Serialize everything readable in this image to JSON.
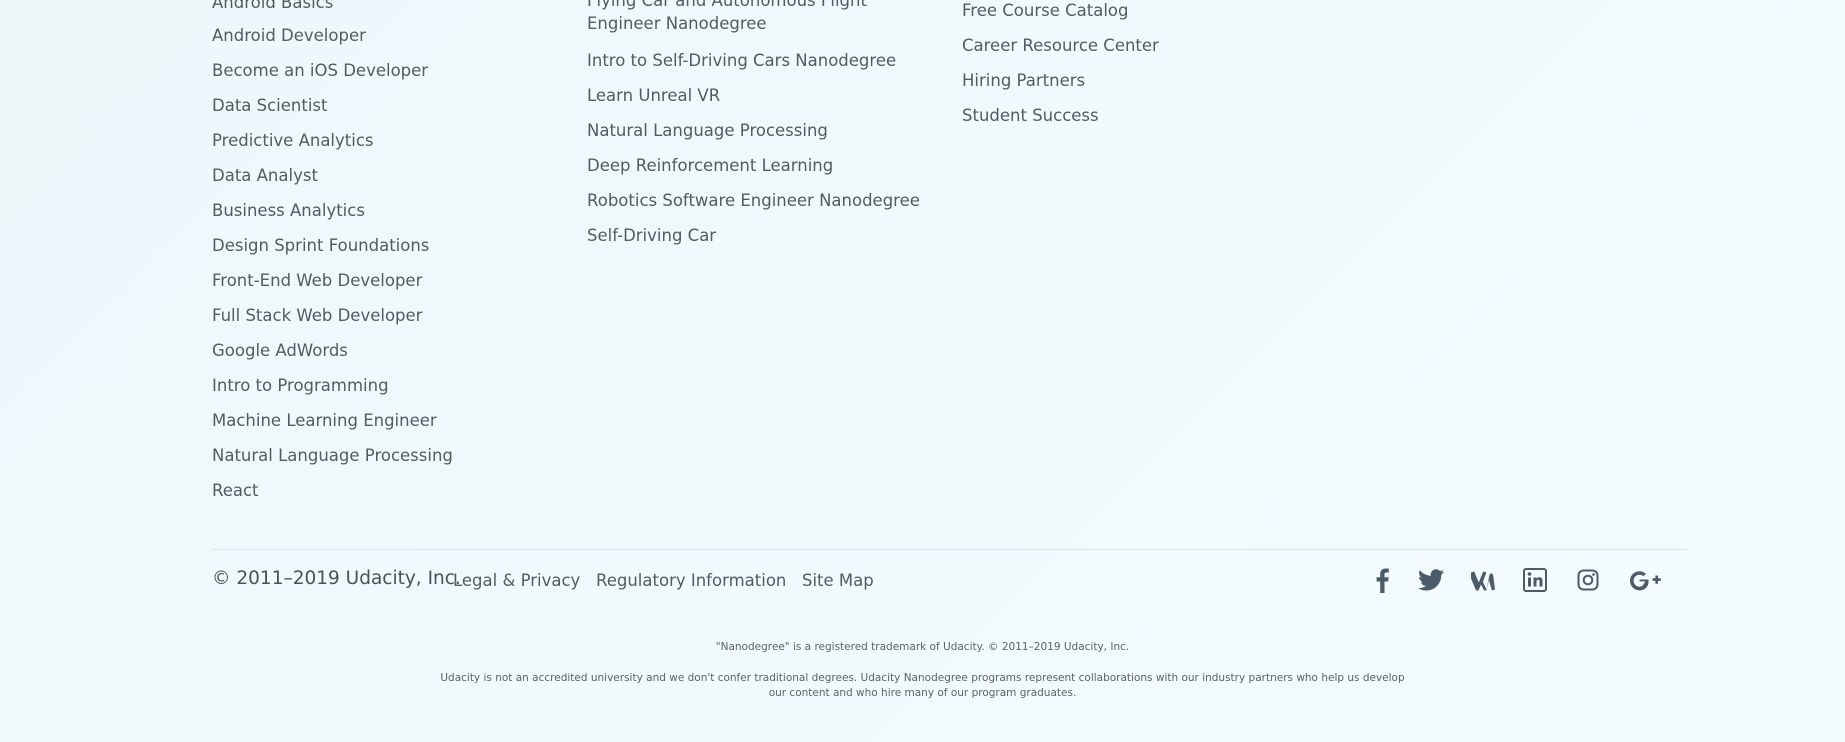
{
  "columns": {
    "programs": [
      "Android Basics",
      "Android Developer",
      "Become an iOS Developer",
      "Data Scientist",
      "Predictive Analytics",
      "Data Analyst",
      "Business Analytics",
      "Design Sprint Foundations",
      "Front-End Web Developer",
      "Full Stack Web Developer",
      "Google AdWords",
      "Intro to Programming",
      "Machine Learning Engineer",
      "Natural Language Processing",
      "React"
    ],
    "programs_2": [
      "Flying Car and Autonomous Flight Engineer Nanodegree",
      "Intro to Self-Driving Cars Nanodegree",
      "Learn Unreal VR",
      "Natural Language Processing",
      "Deep Reinforcement Learning",
      "Robotics Software Engineer Nanodegree",
      "Self-Driving Car"
    ],
    "resources": [
      "Free Course Catalog",
      "Career Resource Center",
      "Hiring Partners",
      "Student Success"
    ]
  },
  "footer": {
    "copyright": "© 2011–2019 Udacity, Inc.",
    "legal_privacy": "Legal & Privacy",
    "regulatory": "Regulatory Information",
    "site_map": "Site Map"
  },
  "social": [
    "facebook-icon",
    "twitter-icon",
    "medium-icon",
    "linkedin-icon",
    "instagram-icon",
    "google-plus-icon"
  ],
  "notices": {
    "trademark": "\"Nanodegree\" is a registered trademark of Udacity. © 2011–2019 Udacity, Inc.",
    "disclaimer": "Udacity is not an accredited university and we don't confer traditional degrees. Udacity Nanodegree programs represent collaborations with our industry partners who help us develop our content and who hire many of our program graduates."
  },
  "colors": {
    "background": "#eef8fb",
    "text": "#525b63",
    "icon": "#4b5b68"
  }
}
